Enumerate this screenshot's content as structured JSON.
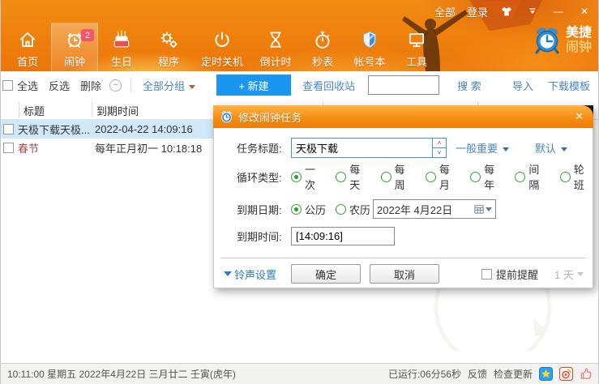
{
  "colors": {
    "accent_orange": "#f08418",
    "button_blue": "#1b96f0",
    "link_blue": "#4a86c8",
    "selected_row": "#cfe8fa",
    "radio_green": "#3aa13a",
    "badge_pink": "#f4556a",
    "festival_red": "#a14a42"
  },
  "icons": {
    "close": "✕",
    "minimize": "—",
    "circle_minus": "−",
    "spinner_up": "˄",
    "spinner_down": "˅"
  },
  "titlebar": {
    "all_link": "全部",
    "login_link": "登录"
  },
  "toolbar": {
    "items": [
      {
        "label": "首页"
      },
      {
        "label": "闹钟",
        "badge": "2"
      },
      {
        "label": "生日"
      },
      {
        "label": "程序"
      },
      {
        "label": "定时关机"
      },
      {
        "label": "倒计时"
      },
      {
        "label": "秒表"
      },
      {
        "label": "帐号本"
      },
      {
        "label": "工具"
      }
    ],
    "logo_line1": "美捷",
    "logo_line2": "闹钟"
  },
  "actionbar": {
    "select_all": "全选",
    "invert_select": "反选",
    "delete": "删除",
    "group_filter": "全部分组",
    "new_button": "+ 新建",
    "recycle_bin": "查看回收站",
    "search_value": "",
    "search_label": "搜  索",
    "import_link": "导入",
    "download_template": "下载模板"
  },
  "table": {
    "columns": [
      "标题",
      "到期时间"
    ],
    "rows": [
      {
        "title": "天极下载天极...",
        "due": "2022-04-22 14:09:16"
      },
      {
        "title": "春节",
        "due": "每年正月初一 10:18:18"
      }
    ]
  },
  "dialog": {
    "title": "修改闹钟任务",
    "task_title_label": "任务标题:",
    "task_title_value": "天极下载",
    "priority": "一般重要",
    "ringtone_group": "默认",
    "repeat_label": "循环类型:",
    "repeat_options": [
      "一次",
      "每天",
      "每周",
      "每月",
      "每年",
      "间隔",
      "轮班"
    ],
    "repeat_selected": "一次",
    "date_label": "到期日期:",
    "calendar_options": [
      "公历",
      "农历"
    ],
    "calendar_selected": "公历",
    "date_value": "2022年  4月22日",
    "time_label": "到期时间:",
    "time_value": "[14:09:16]",
    "footer": {
      "ringtone_settings": "铃声设置",
      "ok": "确定",
      "cancel": "取消",
      "remind_early": "提前提醒",
      "remind_value": "1 天"
    }
  },
  "statusbar": {
    "datetime": "10:11:00 星期五 2022年4月22日 三月廿二 壬寅(虎年)",
    "runtime": "已运行:06分56秒",
    "feedback": "反馈",
    "check_update": "检查更新"
  }
}
